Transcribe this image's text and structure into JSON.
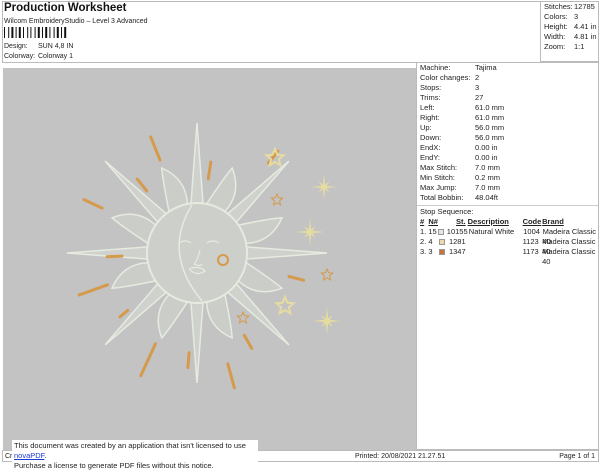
{
  "header": {
    "title": "Production Worksheet",
    "subtitle": "Wilcom EmbroideryStudio – Level 3 Advanced",
    "design_label": "Design:",
    "design_value": "SUN 4,8 IN",
    "colorway_label": "Colorway:",
    "colorway_value": "Colorway 1"
  },
  "stats": [
    {
      "k": "Stitches:",
      "v": "12785"
    },
    {
      "k": "Colors:",
      "v": "3"
    },
    {
      "k": "Height:",
      "v": "4.41 in"
    },
    {
      "k": "Width:",
      "v": "4.81 in"
    },
    {
      "k": "Zoom:",
      "v": "1:1"
    }
  ],
  "info": [
    {
      "k": "Machine:",
      "v": "Tajima"
    },
    {
      "k": "Color changes:",
      "v": "2"
    },
    {
      "k": "Stops:",
      "v": "3"
    },
    {
      "k": "Trims:",
      "v": "27"
    },
    {
      "k": "Left:",
      "v": "61.0 mm"
    },
    {
      "k": "Right:",
      "v": "61.0 mm"
    },
    {
      "k": "Up:",
      "v": "56.0 mm"
    },
    {
      "k": "Down:",
      "v": "56.0 mm"
    },
    {
      "k": "EndX:",
      "v": "0.00 in"
    },
    {
      "k": "EndY:",
      "v": "0.00 in"
    },
    {
      "k": "Max Stitch:",
      "v": "7.0 mm"
    },
    {
      "k": "Min Stitch:",
      "v": "0.2 mm"
    },
    {
      "k": "Max Jump:",
      "v": "7.0 mm"
    },
    {
      "k": "Total Bobbin:",
      "v": "48.04ft"
    }
  ],
  "stop_sequence": {
    "title": "Stop Sequence:",
    "headers": [
      "#",
      "N#",
      "St.",
      "Description",
      "Code",
      "Brand"
    ],
    "rows": [
      {
        "num": "1.",
        "n": "15",
        "color": "#e4e6ea",
        "st": "10155",
        "desc": "Natural White",
        "code": "1004",
        "brand": "Madeira Classic 40"
      },
      {
        "num": "2.",
        "n": "4",
        "color": "#ecd9a6",
        "st": "1281",
        "desc": "",
        "code": "1123",
        "brand": "Madeira Classic 40"
      },
      {
        "num": "3.",
        "n": "3",
        "color": "#c8733a",
        "st": "1347",
        "desc": "",
        "code": "1173",
        "brand": "Madeira Classic 40"
      }
    ]
  },
  "footer": {
    "left": "Cr",
    "printed": "Printed: 20/08/2021 21.27.51",
    "page": "Page 1 of 1"
  },
  "notice": {
    "line1": "This document was created by an application that isn't licensed to use ",
    "link": "novaPDF",
    "line1_end": ".",
    "line2": "Purchase a license to generate PDF files without this notice."
  }
}
